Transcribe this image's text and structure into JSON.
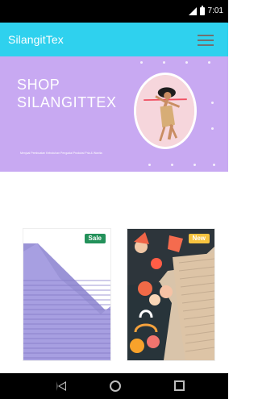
{
  "status_bar": {
    "time": "7:01",
    "signal_icon": "signal-icon",
    "battery_icon": "battery-icon"
  },
  "app_bar": {
    "title": "SilangitTex",
    "menu_icon": "hamburger-menu-icon",
    "background_color": "#2fd1ee"
  },
  "hero": {
    "title_line_1": "SHOP",
    "title_line_2": "SILANGITTEX",
    "subtitle": "Menjual Pembuatan Kebutuhan Pengadai Produksi Pria & Wanita",
    "background_color": "#c8a9f2"
  },
  "products": [
    {
      "badge": "Sale",
      "badge_color": "#23915a",
      "image": "lavender-ribbed-fabric-icon"
    },
    {
      "badge": "New",
      "badge_color": "#f6c33f",
      "image": "printed-fabric-icon"
    }
  ],
  "navigation": {
    "back_icon": "back-icon",
    "home_icon": "home-icon",
    "recent_icon": "recent-apps-icon"
  }
}
